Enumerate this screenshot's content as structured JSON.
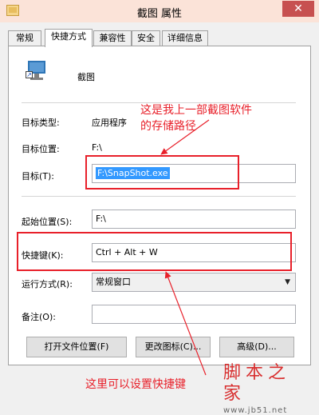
{
  "window": {
    "title": "截图 属性",
    "close_symbol": "✕"
  },
  "tabs": [
    {
      "label": "常规"
    },
    {
      "label": "快捷方式",
      "active": true
    },
    {
      "label": "兼容性"
    },
    {
      "label": "安全"
    },
    {
      "label": "详细信息"
    }
  ],
  "app": {
    "name": "截图",
    "icon": "shortcut-app-icon"
  },
  "fields": {
    "target_type_label": "目标类型:",
    "target_type_value": "应用程序",
    "target_location_label": "目标位置:",
    "target_location_value": "F:\\",
    "target_label": "目标(T):",
    "target_value": "F:\\SnapShot.exe",
    "start_in_label": "起始位置(S):",
    "start_in_value": "F:\\",
    "shortcut_key_label": "快捷键(K):",
    "shortcut_key_value": "Ctrl + Alt + W",
    "run_label": "运行方式(R):",
    "run_value": "常规窗口",
    "comment_label": "备注(O):",
    "comment_value": ""
  },
  "buttons": {
    "open_location": "打开文件位置(F)",
    "change_icon": "更改图标(C)...",
    "advanced": "高级(D)..."
  },
  "annotations": {
    "top_line1": "这是我上一部截图软件",
    "top_line2": "的存储路径",
    "bottom": "这里可以设置快捷键",
    "color": "#e8202a"
  },
  "watermark": {
    "text": "脚本之家",
    "url": "www.jb51.net"
  }
}
